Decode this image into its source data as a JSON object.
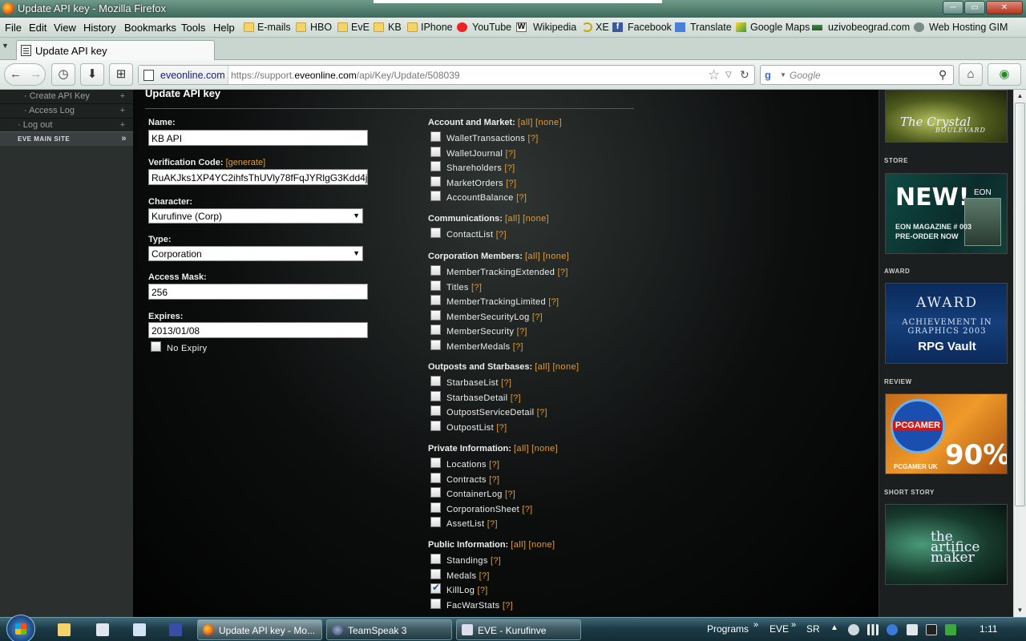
{
  "window": {
    "title": "Update API key - Mozilla Firefox",
    "min": "─",
    "max": "▭",
    "close": "✕"
  },
  "menu": [
    "File",
    "Edit",
    "View",
    "History",
    "Bookmarks",
    "Tools",
    "Help"
  ],
  "bookmarks": [
    "E-mails",
    "HBO",
    "EvE",
    "KB",
    "IPhone",
    "YouTube",
    "Wikipedia",
    "XE",
    "Facebook",
    "Translate",
    "Google Maps",
    "uzivobeograd.com",
    "Web Hosting GIM"
  ],
  "tab": {
    "label": "Update API key",
    "list_glyph": "▼"
  },
  "nav": {
    "back": "←",
    "forward": "→",
    "history": "◷",
    "download": "⬇",
    "addon": "⊞",
    "home": "⌂"
  },
  "address": {
    "domain": "eveonline.com",
    "url_prefix": "https://support.",
    "url_host": "eveonline.com",
    "url_path": "/api/Key/Update/508039",
    "star": "☆",
    "dropdown": "▽",
    "reload": "↻"
  },
  "search": {
    "engine": "g",
    "placeholder": "Google",
    "icon": "search-icon"
  },
  "leftnav": {
    "items": [
      {
        "label": "· Create API Key",
        "plus": "+"
      },
      {
        "label": "· Access Log",
        "plus": "+"
      },
      {
        "label": "· Log out",
        "plus": "+"
      }
    ],
    "main_site": "EVE MAIN SITE",
    "main_arrow": "»"
  },
  "page": {
    "title": "Update API key"
  },
  "form": {
    "name_label": "Name:",
    "name_value": "KB API",
    "vcode_label": "Verification Code:",
    "generate": "[generate]",
    "vcode_value": "RuAKJks1XP4YC2ihfsThUVly78fFqJYRlgG3Kdd4j",
    "character_label": "Character:",
    "character_value": "Kurufinve (Corp)",
    "type_label": "Type:",
    "type_value": "Corporation",
    "mask_label": "Access Mask:",
    "mask_value": "256",
    "expires_label": "Expires:",
    "expires_value": "2013/01/08",
    "no_expiry": "No Expiry"
  },
  "groups": [
    {
      "title": "Account and Market:",
      "all": "[all]",
      "none": "[none]",
      "items": [
        {
          "label": "WalletTransactions",
          "checked": false
        },
        {
          "label": "WalletJournal",
          "checked": false
        },
        {
          "label": "Shareholders",
          "checked": false
        },
        {
          "label": "MarketOrders",
          "checked": false
        },
        {
          "label": "AccountBalance",
          "checked": false
        }
      ]
    },
    {
      "title": "Communications:",
      "all": "[all]",
      "none": "[none]",
      "items": [
        {
          "label": "ContactList",
          "checked": false
        }
      ]
    },
    {
      "title": "Corporation Members:",
      "all": "[all]",
      "none": "[none]",
      "items": [
        {
          "label": "MemberTrackingExtended",
          "checked": false
        },
        {
          "label": "Titles",
          "checked": false
        },
        {
          "label": "MemberTrackingLimited",
          "checked": false
        },
        {
          "label": "MemberSecurityLog",
          "checked": false
        },
        {
          "label": "MemberSecurity",
          "checked": false
        },
        {
          "label": "MemberMedals",
          "checked": false
        }
      ]
    },
    {
      "title": "Outposts and Starbases:",
      "all": "[all]",
      "none": "[none]",
      "items": [
        {
          "label": "StarbaseList",
          "checked": false
        },
        {
          "label": "StarbaseDetail",
          "checked": false
        },
        {
          "label": "OutpostServiceDetail",
          "checked": false
        },
        {
          "label": "OutpostList",
          "checked": false
        }
      ]
    },
    {
      "title": "Private Information:",
      "all": "[all]",
      "none": "[none]",
      "items": [
        {
          "label": "Locations",
          "checked": false
        },
        {
          "label": "Contracts",
          "checked": false
        },
        {
          "label": "ContainerLog",
          "checked": false
        },
        {
          "label": "CorporationSheet",
          "checked": false
        },
        {
          "label": "AssetList",
          "checked": false
        }
      ]
    },
    {
      "title": "Public Information:",
      "all": "[all]",
      "none": "[none]",
      "items": [
        {
          "label": "Standings",
          "checked": false
        },
        {
          "label": "Medals",
          "checked": false
        },
        {
          "label": "KillLog",
          "checked": true
        },
        {
          "label": "FacWarStats",
          "checked": false
        }
      ]
    }
  ],
  "help_link": "[?]",
  "sidebar": {
    "crystal": "The Crystal",
    "crystal_sub": "BOULEVARD",
    "store": "STORE",
    "store_new": "NEW!",
    "store_eon": "EON",
    "store_l1": "EON MAGAZINE # 003",
    "store_l2": "PRE-ORDER NOW",
    "award": "AWARD",
    "award_t1": "AWARD",
    "award_t2": "ACHIEVEMENT IN GRAPHICS 2003",
    "award_t3": "RPG Vault",
    "review": "REVIEW",
    "review_pg": "PCGAMER",
    "review_pct": "90%",
    "review_uk": "PCGAMER UK",
    "short": "SHORT STORY",
    "short_t": "the artifice maker"
  },
  "taskbar": {
    "apps": [
      {
        "label": "Update API key - Mo..."
      },
      {
        "label": "TeamSpeak 3"
      },
      {
        "label": "EVE - Kurufinve"
      }
    ],
    "programs": "Programs",
    "eve": "EVE",
    "sr": "SR",
    "chev": "»",
    "time": "1:11"
  }
}
